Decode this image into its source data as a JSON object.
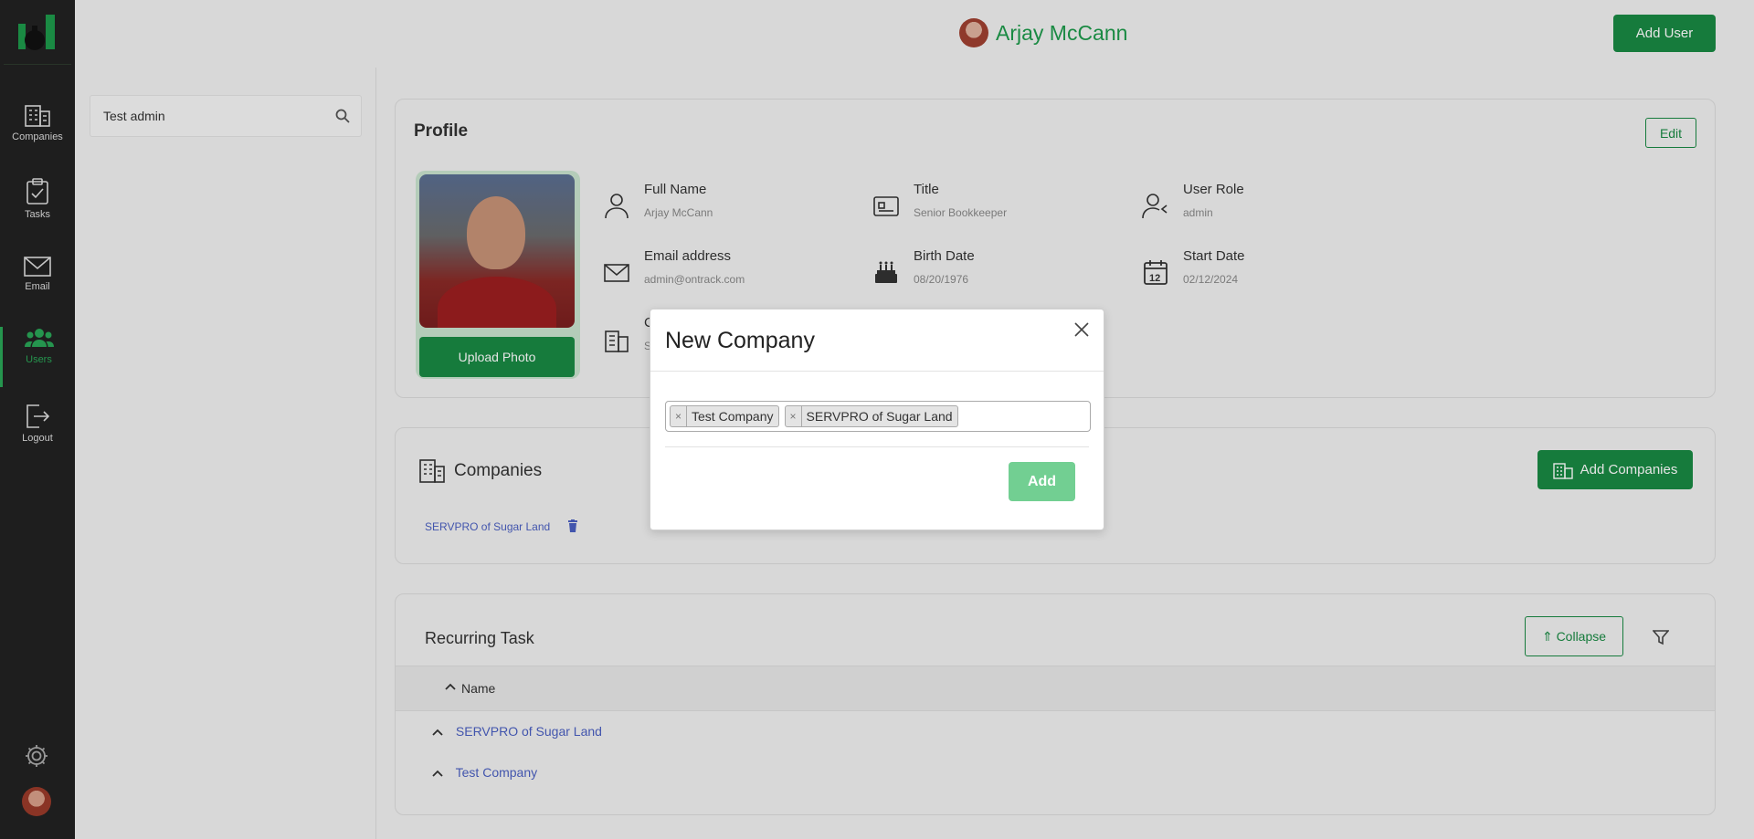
{
  "sidebar": {
    "items": [
      {
        "label": "Companies",
        "icon": "building-icon"
      },
      {
        "label": "Tasks",
        "icon": "clipboard-check-icon"
      },
      {
        "label": "Email",
        "icon": "envelope-icon"
      },
      {
        "label": "Users",
        "icon": "users-icon",
        "active": true
      },
      {
        "label": "Logout",
        "icon": "logout-icon"
      }
    ]
  },
  "header": {
    "user_name": "Arjay McCann",
    "add_user_label": "Add User"
  },
  "search": {
    "value": "Test admin"
  },
  "profile": {
    "title": "Profile",
    "edit_label": "Edit",
    "upload_label": "Upload Photo",
    "fields": {
      "full_name_label": "Full Name",
      "full_name": "Arjay McCann",
      "title_label": "Title",
      "title_value": "Senior Bookkeeper",
      "role_label": "User Role",
      "role": "admin",
      "email_label": "Email address",
      "email": "admin@ontrack.com",
      "birth_label": "Birth Date",
      "birth": "08/20/1976",
      "start_label": "Start Date",
      "start": "02/12/2024",
      "partial_label": "C",
      "partial_value": "S"
    }
  },
  "companies": {
    "title": "Companies",
    "add_label": "Add Companies",
    "items": [
      "SERVPRO of Sugar Land"
    ]
  },
  "recurring": {
    "title": "Recurring Task",
    "collapse_label": "Collapse",
    "column_name": "Name",
    "rows": [
      "SERVPRO of Sugar Land",
      "Test Company"
    ]
  },
  "modal": {
    "title": "New Company",
    "tags": [
      "Test Company",
      "SERVPRO of Sugar Land"
    ],
    "tag_remove": "×",
    "add_label": "Add"
  },
  "colors": {
    "brand": "#198a43",
    "accent": "#2aa657",
    "link": "#4a5fc1",
    "sidebar": "#222222"
  }
}
